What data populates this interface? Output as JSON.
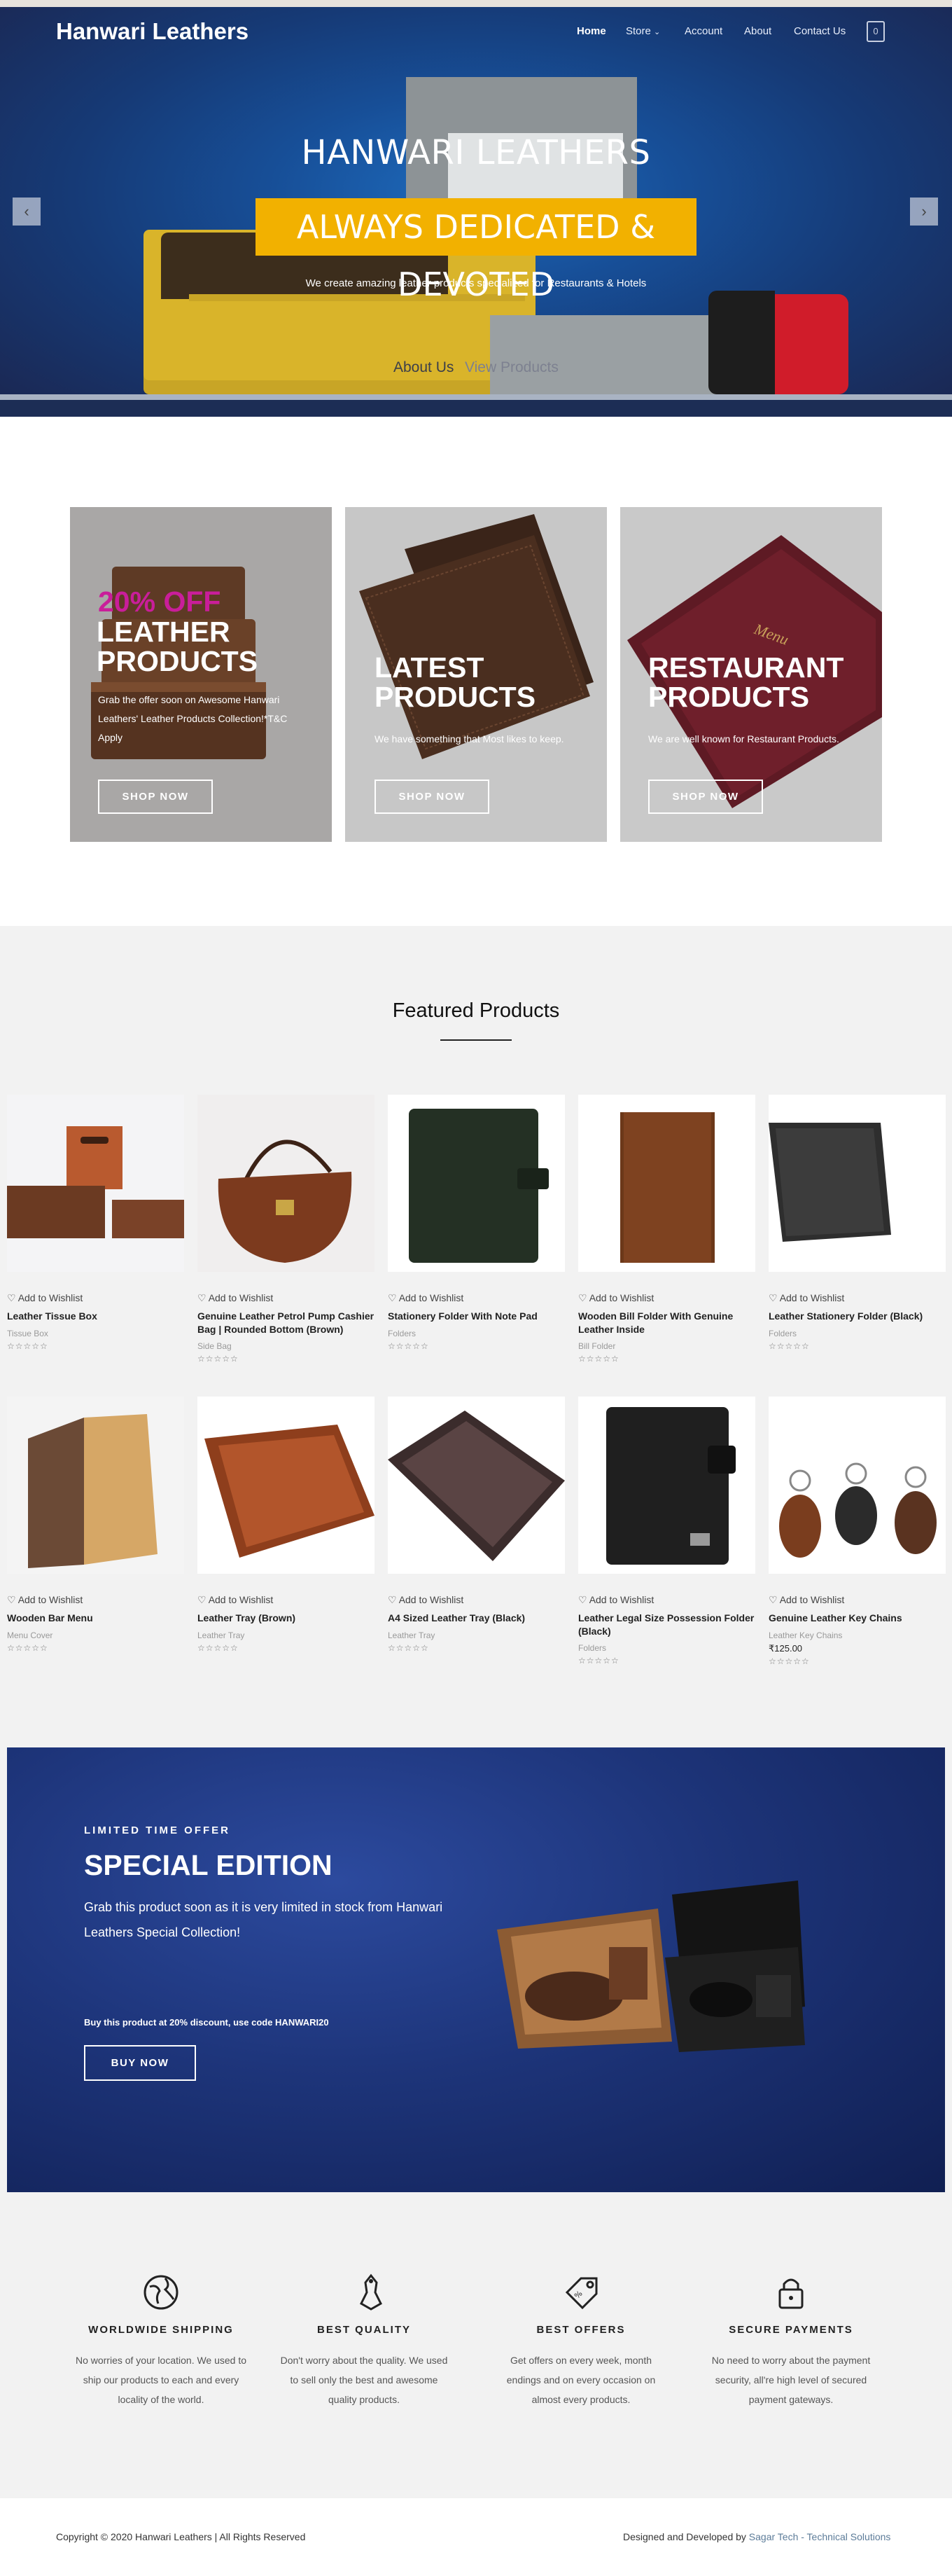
{
  "header": {
    "brand": "Hanwari Leathers",
    "nav": [
      "Home",
      "Store",
      "Account",
      "About",
      "Contact Us"
    ],
    "cart_count": "0"
  },
  "hero": {
    "title": "HANWARI LEATHERS",
    "subtitle": "ALWAYS DEDICATED & DEVOTED",
    "description": "We create amazing leather products specialized for Restaurants & Hotels",
    "buttons": [
      "About Us",
      "View Products"
    ]
  },
  "promos": [
    {
      "offer": "20% OFF",
      "title": [
        "LEATHER",
        "PRODUCTS"
      ],
      "text": [
        "Grab the offer soon on Awesome Hanwari",
        "Leathers' Leather Products Collection!*T&C",
        "Apply"
      ],
      "button": "SHOP NOW"
    },
    {
      "title": [
        "LATEST",
        "PRODUCTS"
      ],
      "text": [
        "We have something that Most likes to keep."
      ],
      "button": "SHOP NOW"
    },
    {
      "title": [
        "RESTAURANT",
        "PRODUCTS"
      ],
      "text": [
        "We are well known for Restaurant Products."
      ],
      "button": "SHOP NOW"
    }
  ],
  "featured": {
    "title": "Featured Products",
    "wishlist_label": "Add to Wishlist",
    "products": [
      {
        "name": [
          "Leather Tissue Box"
        ],
        "category": "Tissue Box"
      },
      {
        "name": [
          "Genuine Leather Petrol Pump Cashier",
          "Bag | Rounded Bottom (Brown)"
        ],
        "category": "Side Bag"
      },
      {
        "name": [
          "Stationery Folder With Note Pad"
        ],
        "category": "Folders"
      },
      {
        "name": [
          "Wooden Bill Folder With Genuine",
          "Leather Inside"
        ],
        "category": "Bill Folder"
      },
      {
        "name": [
          "Leather Stationery Folder (Black)"
        ],
        "category": "Folders"
      },
      {
        "name": [
          "Wooden Bar Menu"
        ],
        "category": "Menu Cover"
      },
      {
        "name": [
          "Leather Tray (Brown)"
        ],
        "category": "Leather Tray"
      },
      {
        "name": [
          "A4 Sized Leather Tray (Black)"
        ],
        "category": "Leather Tray"
      },
      {
        "name": [
          "Leather Legal Size Possession Folder",
          "(Black)"
        ],
        "category": "Folders"
      },
      {
        "name": [
          "Genuine Leather Key Chains"
        ],
        "category": "Leather Key Chains",
        "price": "₹125.00"
      }
    ]
  },
  "special": {
    "kicker": "LIMITED TIME OFFER",
    "title": "SPECIAL EDITION",
    "text": [
      "Grab this product soon as it is very limited in stock from Hanwari",
      "Leathers Special Collection!"
    ],
    "code_text": "Buy this product at 20% discount, use code HANWARI20",
    "button": "BUY NOW"
  },
  "features": [
    {
      "icon": "globe-icon",
      "title": "WORLDWIDE SHIPPING",
      "text": [
        "No worries of your location. We used to",
        "ship our products to each and every",
        "locality of the world."
      ]
    },
    {
      "icon": "badge-icon",
      "title": "BEST QUALITY",
      "text": [
        "Don't worry about the quality. We used",
        "to sell only the best and awesome",
        "quality products."
      ]
    },
    {
      "icon": "tag-icon",
      "title": "BEST OFFERS",
      "text": [
        "Get offers on every week, month",
        "endings and on every occasion on",
        "almost every products."
      ]
    },
    {
      "icon": "lock-icon",
      "title": "SECURE PAYMENTS",
      "text": [
        "No need to worry about the payment",
        "security, all're high level of secured",
        "payment gateways."
      ]
    }
  ],
  "footer": {
    "copyright": "Copyright © 2020 Hanwari Leathers | All Rights Reserved",
    "designed_prefix": "Designed and Developed by",
    "designed_by": "Sagar Tech - Technical Solutions"
  },
  "colors": {
    "accent": "#f2b100",
    "hero_blue": "#174f98",
    "offer_pink": "#c91e9a",
    "special_blue": "#1d3479"
  }
}
